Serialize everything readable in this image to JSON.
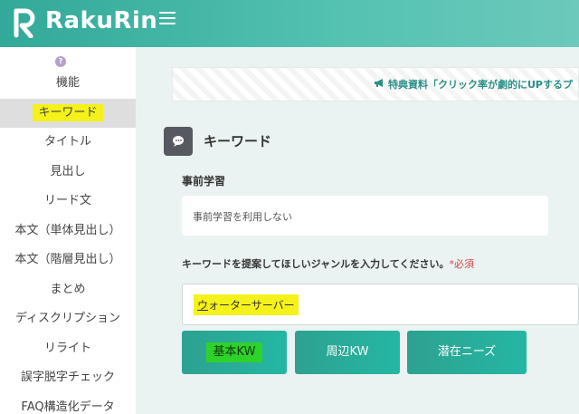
{
  "header": {
    "logo_text": "RakuRin",
    "menu_icon": "hamburger-icon"
  },
  "sidebar": {
    "top_icon": "help-bubble-icon",
    "items": [
      {
        "label": "機能"
      },
      {
        "label": "キーワード"
      },
      {
        "label": "タイトル"
      },
      {
        "label": "見出し"
      },
      {
        "label": "リード文"
      },
      {
        "label": "本文（単体見出し）"
      },
      {
        "label": "本文（階層見出し）"
      },
      {
        "label": "まとめ"
      },
      {
        "label": "ディスクリプション"
      },
      {
        "label": "リライト"
      },
      {
        "label": "誤字脱字チェック"
      },
      {
        "label": "FAQ構造化データ"
      }
    ]
  },
  "banner": {
    "text": "特典資料「クリック率が劇的にUPするプ",
    "icon": "megaphone-icon"
  },
  "section": {
    "title": "キーワード",
    "icon": "chat-bubble-icon"
  },
  "form": {
    "pretrain_label": "事前学習",
    "pretrain_value": "事前学習を利用しない",
    "genre_label": "キーワードを提案してほしいジャンルを入力してください。",
    "required_mark": "*必須",
    "genre_value_first": "ウ",
    "genre_value_rest": "ォーターサーバー"
  },
  "buttons": {
    "basic": "基本KW",
    "around": "周辺KW",
    "latent": "潜在ニーズ"
  },
  "colors": {
    "header_accent": "#32a999",
    "button_accent": "#24b7a3",
    "highlight": "#f4f21a"
  }
}
